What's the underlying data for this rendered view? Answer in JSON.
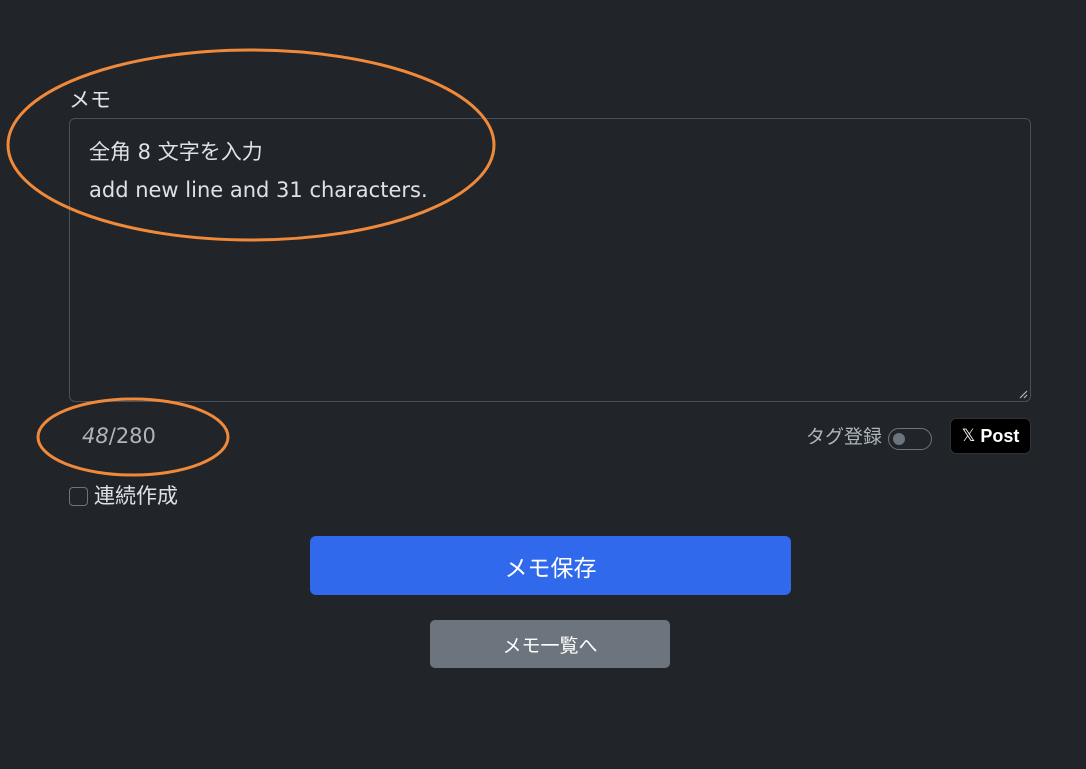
{
  "memo": {
    "label": "メモ",
    "lines": [
      "全角 8 文字を入力",
      "add new line and 31 characters."
    ]
  },
  "counter": {
    "current": "48",
    "separator": "/",
    "max": "280"
  },
  "tag_toggle": {
    "label": "タグ登録",
    "state": "off"
  },
  "x_post": {
    "icon": "x-logo-icon",
    "icon_glyph": "𝕏",
    "label": "Post"
  },
  "continuous": {
    "label": "連続作成",
    "checked": false
  },
  "buttons": {
    "save_label": "メモ保存",
    "list_label": "メモ一覧へ"
  },
  "colors": {
    "background": "#212529",
    "primary": "#3069ec",
    "secondary": "#6c757d",
    "annotation": "#f0893a"
  }
}
